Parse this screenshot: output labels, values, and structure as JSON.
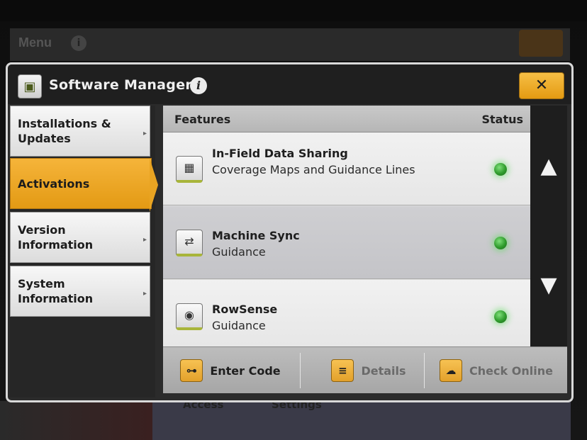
{
  "background": {
    "menu_title": "Menu",
    "bottom_labels": [
      "Access",
      "Settings"
    ]
  },
  "dialog": {
    "title": "Software Manager",
    "close_glyph": "✕",
    "info_glyph": "i"
  },
  "sidebar": {
    "items": [
      {
        "label": "Installations & Updates",
        "active": false
      },
      {
        "label": "Activations",
        "active": true
      },
      {
        "label": "Version Information",
        "active": false
      },
      {
        "label": "System Information",
        "active": false
      }
    ]
  },
  "panel": {
    "header_features": "Features",
    "header_status": "Status",
    "rows": [
      {
        "name": "In-Field Data Sharing",
        "desc": "Coverage Maps and Guidance Lines",
        "icon": "data-sharing-icon",
        "status": "active"
      },
      {
        "name": "Machine Sync",
        "desc": "Guidance",
        "icon": "machine-sync-icon",
        "status": "active"
      },
      {
        "name": "RowSense",
        "desc": "Guidance",
        "icon": "rowsense-icon",
        "status": "active"
      }
    ]
  },
  "scroll": {
    "up": "▲",
    "down": "▼"
  },
  "toolbar": {
    "enter_code": "Enter Code",
    "details": "Details",
    "check_online": "Check Online"
  },
  "colors": {
    "accent": "#E9A422",
    "status_green": "#3FB33A",
    "guidance_bar": "#A8B53A"
  }
}
